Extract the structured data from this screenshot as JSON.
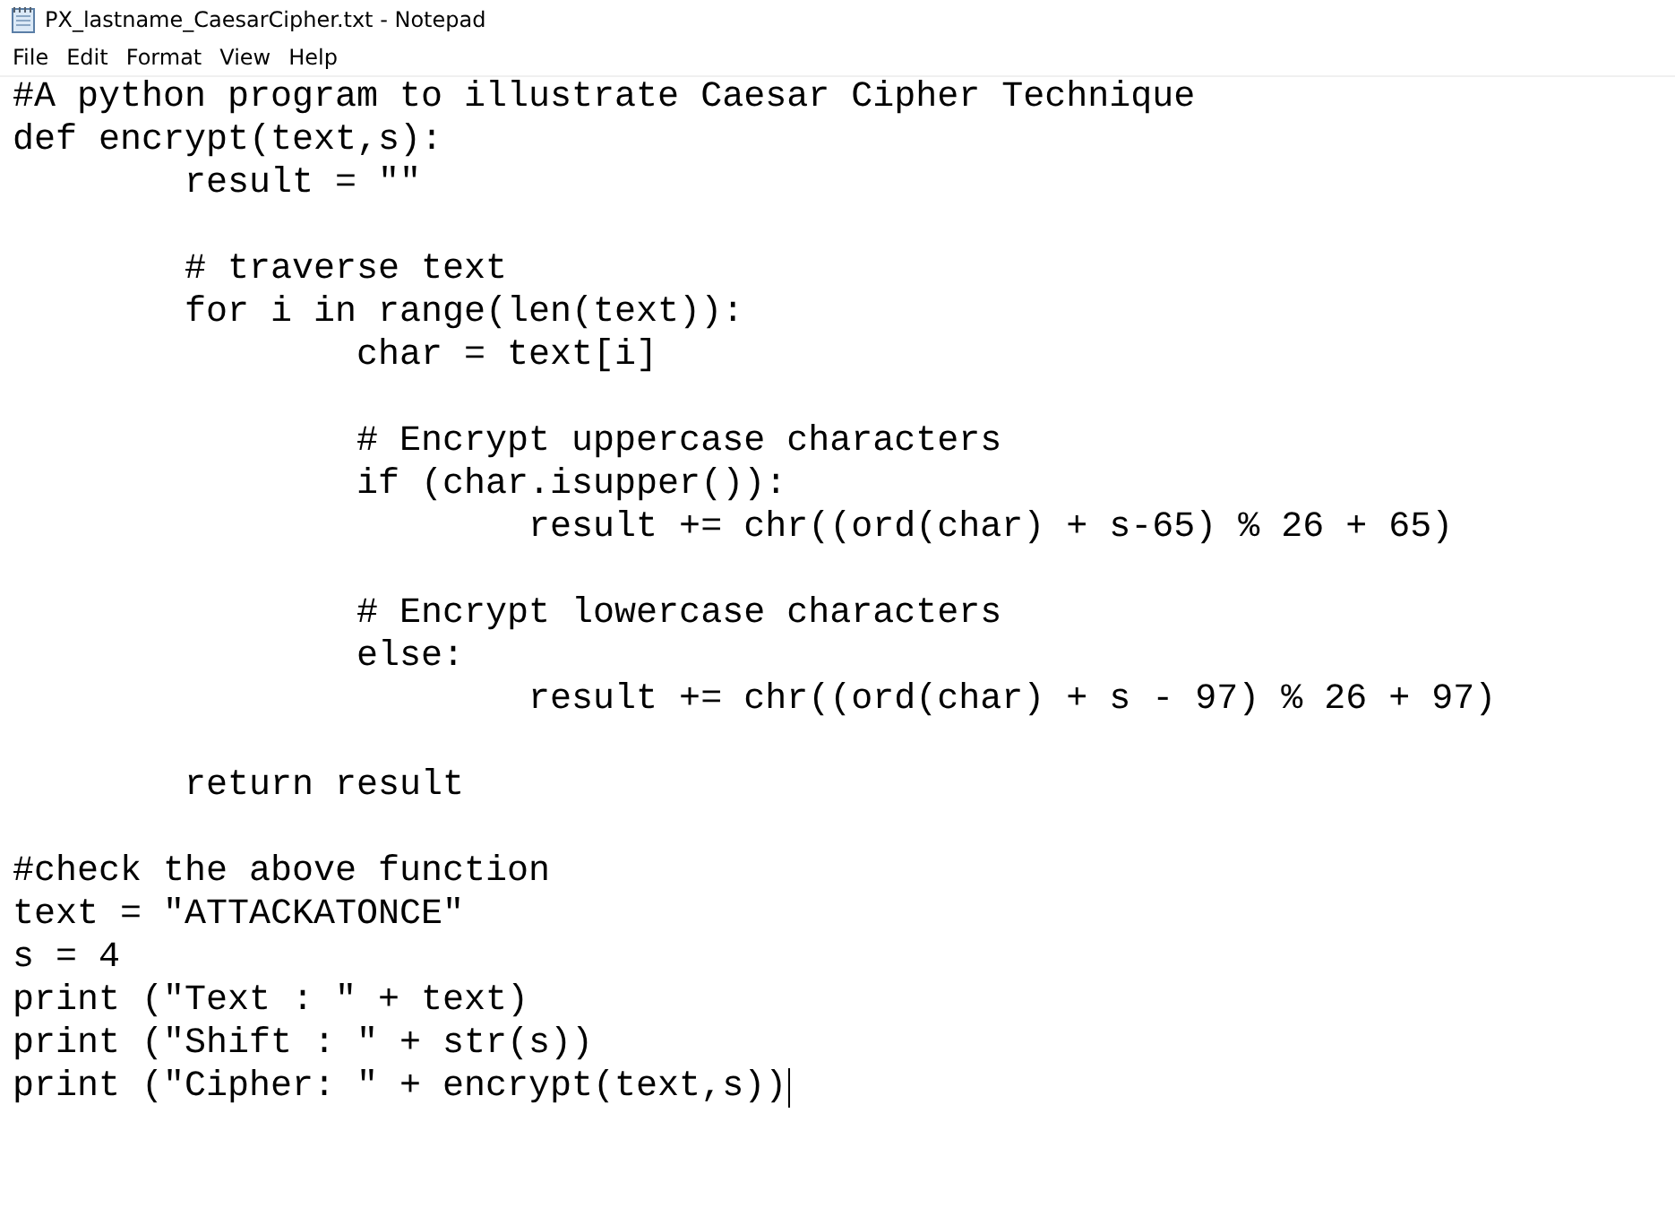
{
  "window": {
    "title": "PX_lastname_CaesarCipher.txt - Notepad"
  },
  "menu": [
    "File",
    "Edit",
    "Format",
    "View",
    "Help"
  ],
  "editor": {
    "blocks": [
      [
        "#A python program to illustrate Caesar Cipher Technique",
        "def encrypt(text,s):",
        "\tresult = \"\""
      ],
      [
        "\t# traverse text",
        "\tfor i in range(len(text)):",
        "\t\tchar = text[i]"
      ],
      [
        "\t\t# Encrypt uppercase characters",
        "\t\tif (char.isupper()):",
        "\t\t\tresult += chr((ord(char) + s-65) % 26 + 65)"
      ],
      [
        "\t\t# Encrypt lowercase characters",
        "\t\telse:",
        "\t\t\tresult += chr((ord(char) + s - 97) % 26 + 97)"
      ],
      [
        "\treturn result"
      ],
      [
        "#check the above function",
        "text = \"ATTACKATONCE\"",
        "s = 4",
        "print (\"Text : \" + text)",
        "print (\"Shift : \" + str(s))",
        "print (\"Cipher: \" + encrypt(text,s))"
      ]
    ]
  }
}
